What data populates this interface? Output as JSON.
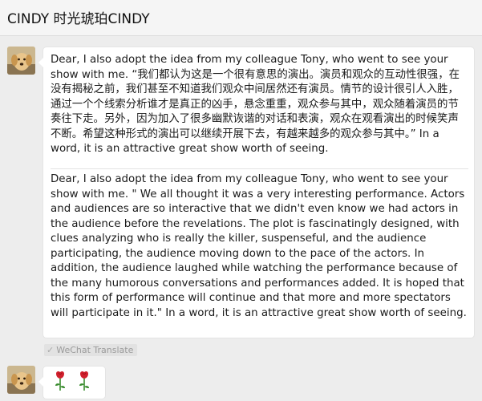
{
  "header": {
    "title": "CINDY 时光琥珀CINDY"
  },
  "messages": [
    {
      "sender_avatar": "dog-avatar-icon",
      "original_text": "Dear, I also adopt the idea from my colleague Tony, who went to see your show with me. “我们都认为这是一个很有意思的演出。演员和观众的互动性很强，在没有揭秘之前，我们甚至不知道我们观众中间居然还有演员。情节的设计很引人入胜，通过一个个线索分析谁才是真正的凶手，悬念重重，观众参与其中，观众随着演员的节奏往下走。另外，因为加入了很多幽默诙谐的对话和表演，观众在观看演出的时候笑声不断。希望这种形式的演出可以继续开展下去，有越来越多的观众参与其中。” In a word, it is an attractive great show worth of seeing.",
      "translated_text": "Dear, I also adopt the idea from my colleague Tony, who went to see your show with me. \" We all thought it was a very interesting performance. Actors and audiences are so interactive that we didn't even know we had actors in the audience before the revelations. The plot is fascinatingly designed, with clues analyzing who is really the killer, suspenseful, and the audience participating, the audience moving down to the pace of the actors. In addition, the audience laughed while watching the performance because of the many humorous conversations and performances added. It is hoped that this form of performance will continue and that more and more spectators will participate in it.\"  In a word, it is an attractive great show worth of seeing.",
      "translate_label": "WeChat Translate"
    },
    {
      "sender_avatar": "dog-avatar-icon",
      "emoji": [
        "rose-emoji",
        "rose-emoji"
      ]
    }
  ],
  "colors": {
    "background": "#ededed",
    "bubble": "#ffffff",
    "topbar": "#f5f5f5",
    "rose_red": "#d0202c",
    "stem_green": "#3a8c2e"
  }
}
